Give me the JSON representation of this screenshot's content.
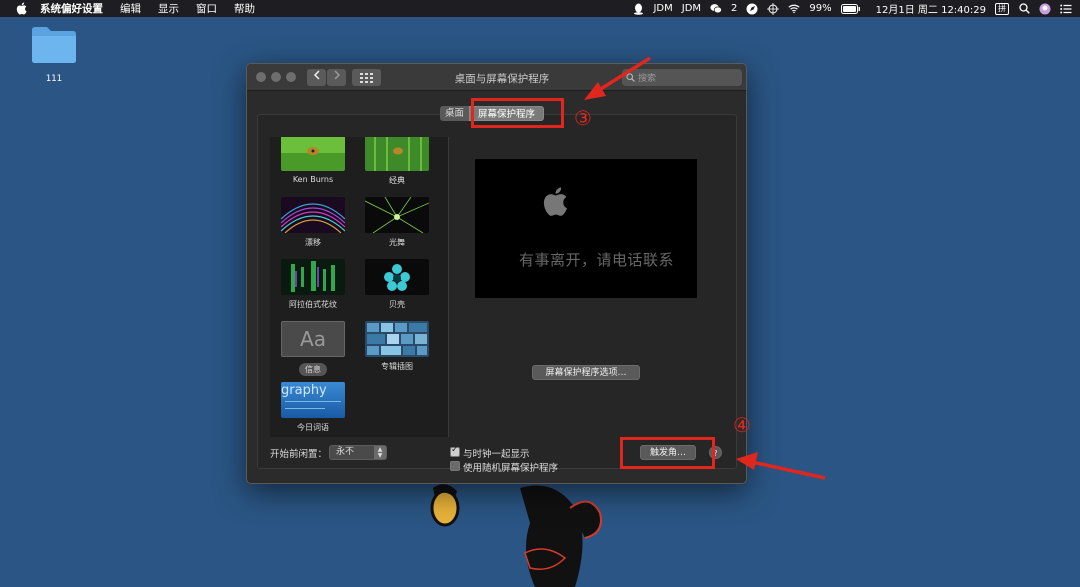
{
  "menubar": {
    "items": [
      "系统偏好设置",
      "编辑",
      "显示",
      "窗口",
      "帮助"
    ],
    "status": {
      "jdm1": "JDM",
      "jdm2": "JDM",
      "wechat_count": "2",
      "battery": "99%",
      "datetime": "12月1日 周二  12:40:29",
      "ime": "拼"
    }
  },
  "desktop": {
    "folder_label": "111"
  },
  "window": {
    "title": "桌面与屏幕保护程序",
    "search_placeholder": "搜索",
    "tabs": [
      "桌面",
      "屏幕保护程序"
    ],
    "selected_tab": "屏幕保护程序"
  },
  "savers": [
    {
      "name": "Ken Burns",
      "thumb": "green-ladybug"
    },
    {
      "name": "经典",
      "thumb": "green-ladybug-classic"
    },
    {
      "name": "漂移",
      "thumb": "magenta-cyan-lines"
    },
    {
      "name": "光舞",
      "thumb": "green-rays"
    },
    {
      "name": "阿拉伯式花纹",
      "thumb": "green-blocks"
    },
    {
      "name": "贝壳",
      "thumb": "cyan-flower"
    },
    {
      "name": "信息",
      "thumb": "aa-tile",
      "thumb_text": "Aa",
      "selected": true
    },
    {
      "name": "专辑插图",
      "thumb": "album-grid"
    },
    {
      "name": "今日词语",
      "thumb": "word-of-day",
      "thumb_text": "graphy"
    }
  ],
  "preview": {
    "message": "有事离开，请电话联系"
  },
  "buttons": {
    "saver_options": "屏幕保护程序选项…",
    "hot_corners": "触发角…",
    "help": "?"
  },
  "bottom": {
    "idle_label": "开始前闲置：",
    "idle_value": "永不",
    "show_clock_label": "与时钟一起显示",
    "show_clock_checked": true,
    "random_label": "使用随机屏幕保护程序",
    "random_checked": false
  },
  "annotations": {
    "step3": "③",
    "step4": "④",
    "color": "#e0261d"
  }
}
